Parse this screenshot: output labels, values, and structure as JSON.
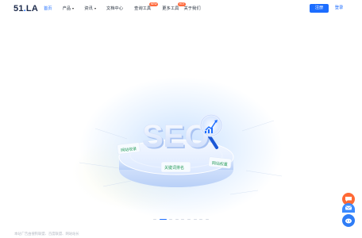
{
  "header": {
    "logo": {
      "main": "51",
      "dot": ".",
      "suffix": "LA"
    },
    "nav": [
      {
        "label": "首页",
        "active": true
      },
      {
        "label": "产品",
        "dropdown": true
      },
      {
        "label": "资讯",
        "dropdown": true
      },
      {
        "label": "文档中心"
      },
      {
        "label": "查询工具",
        "badge": "NEW"
      },
      {
        "label": "更多工具",
        "badge": "HOT"
      },
      {
        "label": "关于我们"
      }
    ],
    "register_label": "注册",
    "login_label": "登录"
  },
  "hero": {
    "illustration": {
      "main_text": "SEO",
      "tags": [
        "网站收录",
        "关键词排名",
        "网站权重"
      ]
    },
    "carousel": {
      "count": 9,
      "active_index": 1
    }
  },
  "footer": {
    "note": "本站广告由搜狗联盟、百度联盟、网站站长"
  },
  "floating": {
    "buttons": [
      "chat-icon",
      "message-icon",
      "headset-icon"
    ]
  },
  "colors": {
    "accent": "#1c6dff",
    "badge": "#ff6a3d",
    "floating_orange": "#ff6a35",
    "floating_blue": "#3c8bff"
  }
}
